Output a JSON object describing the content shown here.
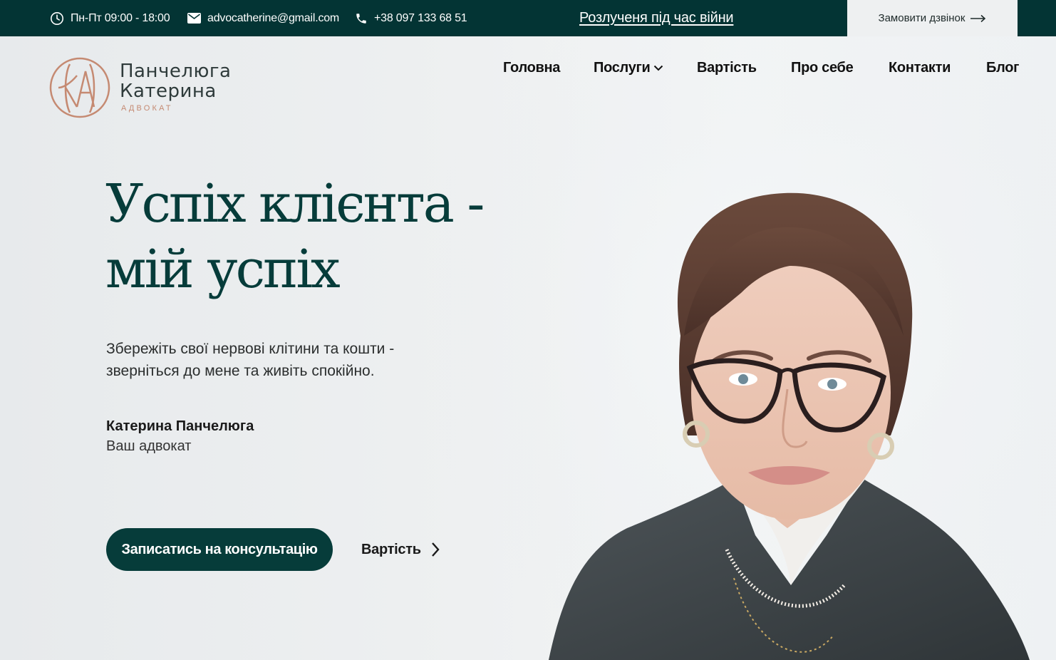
{
  "topbar": {
    "hours": "Пн-Пт 09:00 - 18:00",
    "email": "advocatherine@gmail.com",
    "phone": "+38 097 133 68 51",
    "promo_link": "Розлученя під час війни",
    "callback_button": "Замовити дзвінок",
    "icons": [
      "clock-icon",
      "envelope-icon",
      "phone-icon",
      "arrow-right-icon"
    ]
  },
  "logo": {
    "monogram": "КА",
    "name_line1": "Панчелюга",
    "name_line2": "Катерина",
    "subtitle": "АДВОКАТ",
    "color": "#c58a72"
  },
  "nav": {
    "items": [
      {
        "label": "Головна"
      },
      {
        "label": "Послуги",
        "has_dropdown": true
      },
      {
        "label": "Вартість"
      },
      {
        "label": "Про себе"
      },
      {
        "label": "Контакти"
      },
      {
        "label": "Блог"
      }
    ]
  },
  "hero": {
    "headline_line1": "Успіх клієнта -",
    "headline_line2": "мій успіх",
    "lead_line1": "Збережіть свої нервові клітини та кошти -",
    "lead_line2": "зверніться до мене та живіть спокійно.",
    "signature_name": "Катерина Панчелюга",
    "signature_role": "Ваш адвокат",
    "cta_button": "Записатись на консультацію",
    "secondary_link": "Вартість"
  },
  "colors": {
    "brand_dark": "#063c3a",
    "topbar_bg": "#033434",
    "accent_copper": "#c58a72",
    "background": "#eef0f1"
  }
}
